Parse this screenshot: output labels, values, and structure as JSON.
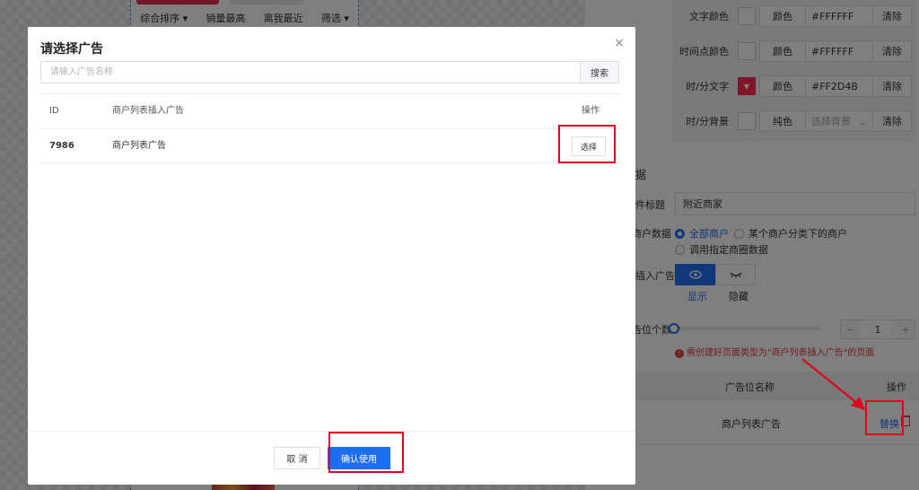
{
  "background": {
    "sort_bar": [
      "综合排序 ▾",
      "销量最高",
      "离我最近",
      "筛选 ▾"
    ],
    "color_rows": [
      {
        "label": "文字颜色",
        "button": "颜色",
        "value": "#FFFFFF",
        "clear": "清除"
      },
      {
        "label": "时间点颜色",
        "button": "颜色",
        "value": "#FFFFFF",
        "clear": "清除"
      },
      {
        "label": "时/分文字",
        "button": "颜色",
        "value": "#FF2D4B",
        "clear": "清除"
      },
      {
        "label": "时/分背景",
        "button": "纯色",
        "value": "选择背景",
        "clear": "清除"
      }
    ],
    "section_title": "据",
    "component_title_label": "件标题",
    "component_title_value": "附近商家",
    "merchant_data_label": "商户数据",
    "merchant_options": [
      "全部商户",
      "某个商户分类下的商户",
      "调用指定商圈数据"
    ],
    "insert_ad_label": "插入广告",
    "show_label": "显示",
    "hide_label": "隐藏",
    "ad_count_label": "告位个数",
    "stepper_minus": "−",
    "stepper_value": "1",
    "stepper_plus": "+",
    "warning": "需创建好页面类型为\"商户列表插入广告\"的页面",
    "table_header_name": "广告位名称",
    "table_header_action": "操作",
    "table_row_name": "商户列表广告",
    "replace_link": "替换"
  },
  "modal": {
    "title": "请选择广告",
    "close": "×",
    "search_placeholder": "请输入广告名称",
    "search_button": "搜索",
    "columns": {
      "id": "ID",
      "name": "商户列表插入广告",
      "action": "操作"
    },
    "rows": [
      {
        "id": "7986",
        "name": "商户列表广告",
        "action": "选择"
      }
    ],
    "cancel": "取 消",
    "confirm": "确认使用"
  },
  "colors": {
    "accent": "#1e6ef4",
    "highlight": "#e0001b",
    "brand_red": "#ff2d4b"
  }
}
